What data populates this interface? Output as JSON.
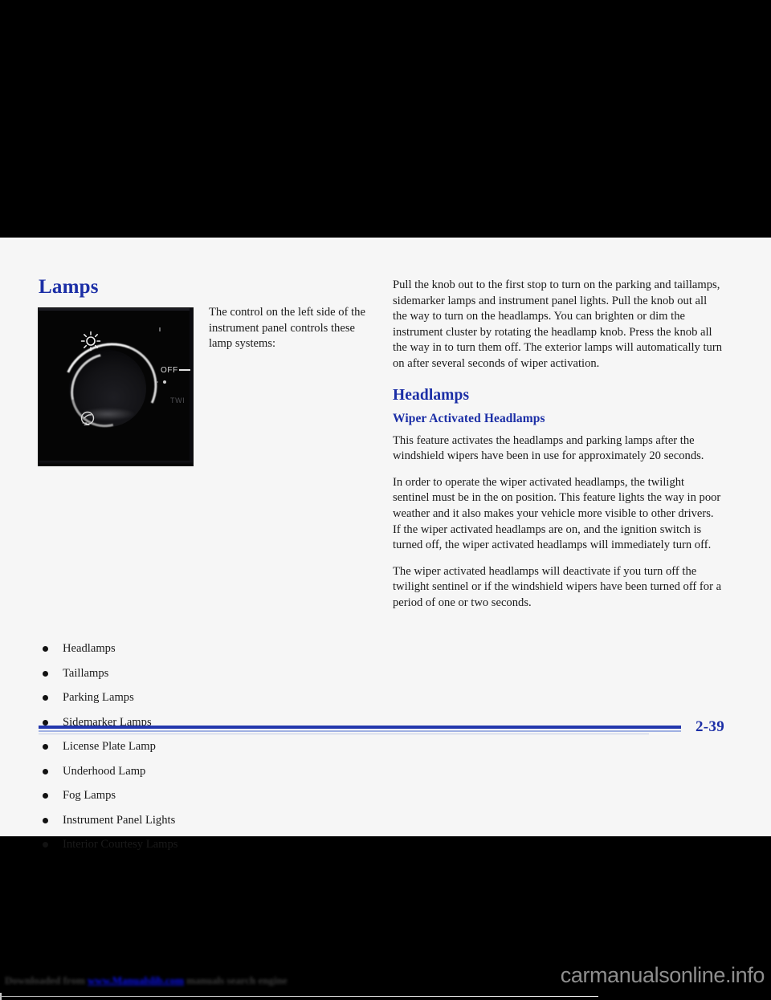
{
  "page": {
    "background_color": "#000000",
    "sheet_color": "#f6f6f6",
    "heading_color": "#1b2ea6",
    "rule_color": "#2337ad",
    "page_number": "2-39"
  },
  "left_column": {
    "section_title": "Lamps",
    "photo": {
      "alt_name": "headlamp-control-knob-photo",
      "labels": {
        "off": "OFF",
        "twilight": "TWI"
      },
      "icons": {
        "headlamp": "sun-headlamp-icon",
        "fog": "fog-lamp-icon"
      }
    },
    "photo_caption": "The control on the left side of the instrument panel controls these lamp systems:",
    "lamp_list": [
      "Headlamps",
      "Taillamps",
      "Parking Lamps",
      "Sidemarker Lamps",
      "License Plate Lamp",
      "Underhood Lamp",
      "Fog Lamps",
      "Instrument Panel Lights",
      "Interior Courtesy Lamps"
    ]
  },
  "right_column": {
    "intro_paragraph": "Pull the knob out to the first stop to turn on the parking and taillamps, sidemarker lamps and instrument panel lights. Pull the knob out all the way to turn on the headlamps. You can brighten or dim the instrument cluster by rotating the headlamp knob. Press the knob all the way in to turn them off. The exterior lamps will automatically turn on after several seconds of wiper activation.",
    "headlamps_title": "Headlamps",
    "wiper_subtitle": "Wiper Activated Headlamps",
    "wiper_paragraph_1": "This feature activates the headlamps and parking lamps after the windshield wipers have been in use for approximately 20 seconds.",
    "wiper_paragraph_2": "In order to operate the wiper activated headlamps, the twilight sentinel must be in the on position. This feature lights the way in poor weather and it also makes your vehicle more visible to other drivers. If the wiper activated headlamps are on, and the ignition switch is turned off, the wiper activated headlamps will immediately turn off.",
    "wiper_paragraph_3": "The wiper activated headlamps will deactivate if you turn off the twilight sentinel or if the windshield wipers have been turned off for a period of one or two seconds."
  },
  "watermarks": {
    "bottom_left_prefix": "Downloaded from ",
    "bottom_left_link": "www.Manualslib.com",
    "bottom_left_suffix": " manuals search engine",
    "bottom_right": "carmanualsonline.info"
  }
}
